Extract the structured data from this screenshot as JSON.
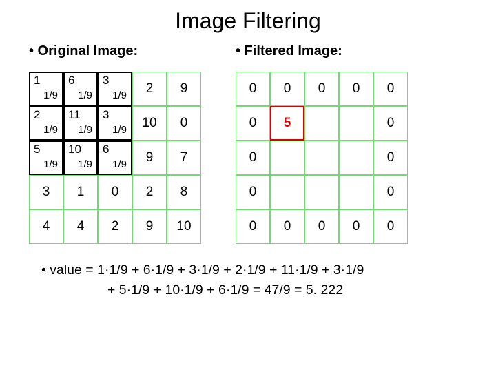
{
  "title": "Image Filtering",
  "left": {
    "label": "•   Original Image:",
    "grid": [
      [
        1,
        6,
        3,
        2,
        9
      ],
      [
        2,
        11,
        3,
        10,
        0
      ],
      [
        5,
        10,
        6,
        9,
        7
      ],
      [
        3,
        1,
        0,
        2,
        8
      ],
      [
        4,
        4,
        2,
        9,
        10
      ]
    ],
    "kernel_label": "1/9"
  },
  "right": {
    "label": "•   Filtered Image:",
    "grid": [
      [
        "0",
        "0",
        "0",
        "0",
        "0"
      ],
      [
        "0",
        "5",
        "",
        "",
        "0"
      ],
      [
        "0",
        "",
        "",
        "",
        "0"
      ],
      [
        "0",
        "",
        "",
        "",
        "0"
      ],
      [
        "0",
        "0",
        "0",
        "0",
        "0"
      ]
    ],
    "highlight": {
      "row": 1,
      "col": 1
    }
  },
  "calc": {
    "prefix": "•   value = ",
    "line1": "1·1/9 + 6·1/9 + 3·1/9 + 2·1/9 + 11·1/9 + 3·1/9",
    "line2": "+ 5·1/9 + 10·1/9 + 6·1/9 = 47/9 = 5. 222"
  }
}
